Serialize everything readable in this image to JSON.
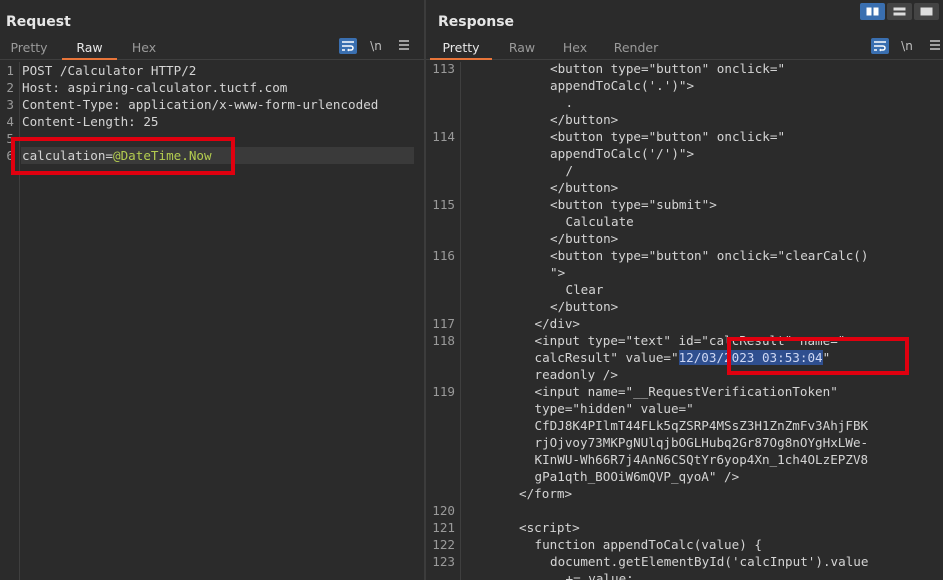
{
  "request": {
    "title": "Request",
    "tabs": [
      "Pretty",
      "Raw",
      "Hex"
    ],
    "active_tab": "Raw",
    "lines": [
      {
        "n": "1",
        "text": "POST /Calculator HTTP/2"
      },
      {
        "n": "2",
        "text": "Host: aspiring-calculator.tuctf.com"
      },
      {
        "n": "3",
        "text": "Content-Type: application/x-www-form-urlencoded"
      },
      {
        "n": "4",
        "text": "Content-Length: 25"
      },
      {
        "n": "5",
        "text": ""
      },
      {
        "n": "6",
        "key": "calculation=",
        "value": "@DateTime.Now"
      }
    ]
  },
  "response": {
    "title": "Response",
    "tabs": [
      "Pretty",
      "Raw",
      "Hex",
      "Render"
    ],
    "active_tab": "Pretty",
    "lines": [
      {
        "n": "113",
        "indent": 4,
        "text": "<button type=\"button\" onclick=\""
      },
      {
        "n": "",
        "indent": 4,
        "text": "appendToCalc('.')\">"
      },
      {
        "n": "",
        "indent": 5,
        "text": "."
      },
      {
        "n": "",
        "indent": 4,
        "text": "</button>"
      },
      {
        "n": "114",
        "indent": 4,
        "text": "<button type=\"button\" onclick=\""
      },
      {
        "n": "",
        "indent": 4,
        "text": "appendToCalc('/')\">"
      },
      {
        "n": "",
        "indent": 5,
        "text": "/"
      },
      {
        "n": "",
        "indent": 4,
        "text": "</button>"
      },
      {
        "n": "115",
        "indent": 4,
        "text": "<button type=\"submit\">"
      },
      {
        "n": "",
        "indent": 5,
        "text": "Calculate"
      },
      {
        "n": "",
        "indent": 4,
        "text": "</button>"
      },
      {
        "n": "116",
        "indent": 4,
        "text": "<button type=\"button\" onclick=\"clearCalc()"
      },
      {
        "n": "",
        "indent": 4,
        "text": "\">"
      },
      {
        "n": "",
        "indent": 5,
        "text": "Clear"
      },
      {
        "n": "",
        "indent": 4,
        "text": "</button>"
      },
      {
        "n": "117",
        "indent": 3,
        "text": "</div>"
      },
      {
        "n": "118",
        "indent": 3,
        "text": "<input type=\"text\" id=\"calcResult\" name=\""
      },
      {
        "n": "",
        "indent": 3,
        "pre": "calcResult\" value=\"",
        "hl": "12/03/2023 03:53:04",
        "post": "\""
      },
      {
        "n": "",
        "indent": 3,
        "text": "readonly />"
      },
      {
        "n": "119",
        "indent": 3,
        "text": "<input name=\"__RequestVerificationToken\""
      },
      {
        "n": "",
        "indent": 3,
        "text": "type=\"hidden\" value=\""
      },
      {
        "n": "",
        "indent": 3,
        "text": "CfDJ8K4PIlmT44FLk5qZSRP4MSsZ3H1ZnZmFv3AhjFBK"
      },
      {
        "n": "",
        "indent": 3,
        "text": "rjOjvoy73MKPgNUlqjbOGLHubq2Gr87Og8nOYgHxLWe-"
      },
      {
        "n": "",
        "indent": 3,
        "text": "KInWU-Wh66R7j4AnN6CSQtYr6yop4Xn_1ch4OLzEPZV8"
      },
      {
        "n": "",
        "indent": 3,
        "text": "gPa1qth_BOOiW6mQVP_qyoA\" />"
      },
      {
        "n": "",
        "indent": 2,
        "text": "</form>"
      },
      {
        "n": "120",
        "indent": 0,
        "text": ""
      },
      {
        "n": "121",
        "indent": 2,
        "text": "<script>"
      },
      {
        "n": "122",
        "indent": 3,
        "text": "function appendToCalc(value) {"
      },
      {
        "n": "123",
        "indent": 4,
        "text": "document.getElementById('calcInput').value"
      },
      {
        "n": "",
        "indent": 5,
        "text": "+= value;"
      }
    ]
  }
}
